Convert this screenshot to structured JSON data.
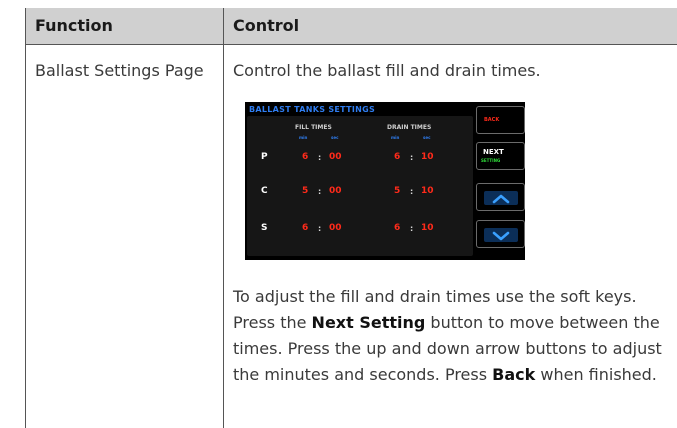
{
  "table": {
    "header_function": "Function",
    "header_control": "Control",
    "function_label": "Ballast Settings Page",
    "control_intro": "Control the ballast fill and drain times."
  },
  "screen": {
    "title": "BALLAST TANKS SETTINGS",
    "fill_times_label": "FILL TIMES",
    "drain_times_label": "DRAIN TIMES",
    "min_label": "min",
    "sec_label": "sec",
    "rows": [
      {
        "label": "P",
        "fill_min": "6",
        "fill_sec": "00",
        "drain_min": "6",
        "drain_sec": "10"
      },
      {
        "label": "C",
        "fill_min": "5",
        "fill_sec": "00",
        "drain_min": "5",
        "drain_sec": "10"
      },
      {
        "label": "S",
        "fill_min": "6",
        "fill_sec": "00",
        "drain_min": "6",
        "drain_sec": "10"
      }
    ],
    "colon": ":",
    "softkeys": {
      "back": "BACK",
      "next": "NEXT",
      "setting": "SETTING"
    },
    "colors": {
      "title_blue": "#2f7df0",
      "value_red": "#ff2a1a",
      "setting_green": "#2fdc3a",
      "cursor_cyan": "#38c7e8"
    }
  },
  "instructions": {
    "part1": "To adjust the fill and drain times use the soft keys. Press the ",
    "bold1": "Next Setting",
    "part2": " button to move between the times. Press the up and down arrow buttons to adjust the minutes and seconds.  Press ",
    "bold2": "Back",
    "part3": " when finished."
  }
}
